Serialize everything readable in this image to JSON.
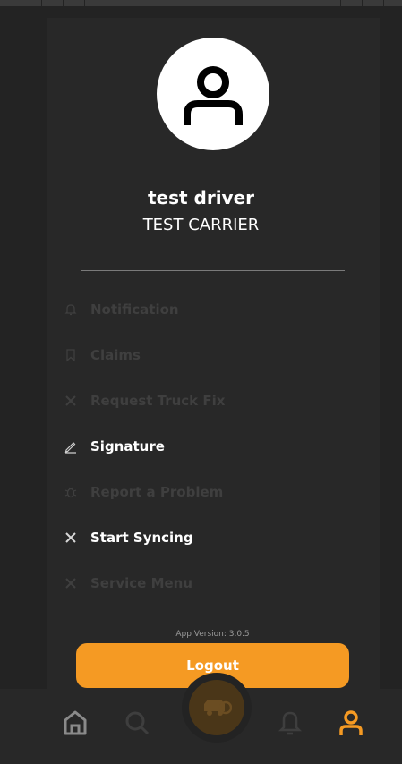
{
  "profile": {
    "name": "test driver",
    "carrier": "TEST CARRIER"
  },
  "menu": {
    "items": [
      {
        "label": "Notification",
        "icon": "bell-icon",
        "enabled": false
      },
      {
        "label": "Claims",
        "icon": "bookmark-icon",
        "enabled": false
      },
      {
        "label": "Request Truck Fix",
        "icon": "tools-icon",
        "enabled": false
      },
      {
        "label": "Signature",
        "icon": "pen-icon",
        "enabled": true
      },
      {
        "label": "Report a Problem",
        "icon": "bug-icon",
        "enabled": false
      },
      {
        "label": "Start Syncing",
        "icon": "tools-icon",
        "enabled": true
      },
      {
        "label": "Service Menu",
        "icon": "tools-icon",
        "enabled": false
      }
    ]
  },
  "footer": {
    "version": "App Version: 3.0.5",
    "logout_label": "Logout"
  },
  "bottom_nav": {
    "items": [
      "home-icon",
      "search-icon",
      "truck-icon",
      "bell-icon",
      "profile-icon"
    ],
    "active": "profile-icon"
  },
  "colors": {
    "accent": "#f59a23",
    "background": "#232323",
    "disabled_text": "#3f3f3f"
  }
}
